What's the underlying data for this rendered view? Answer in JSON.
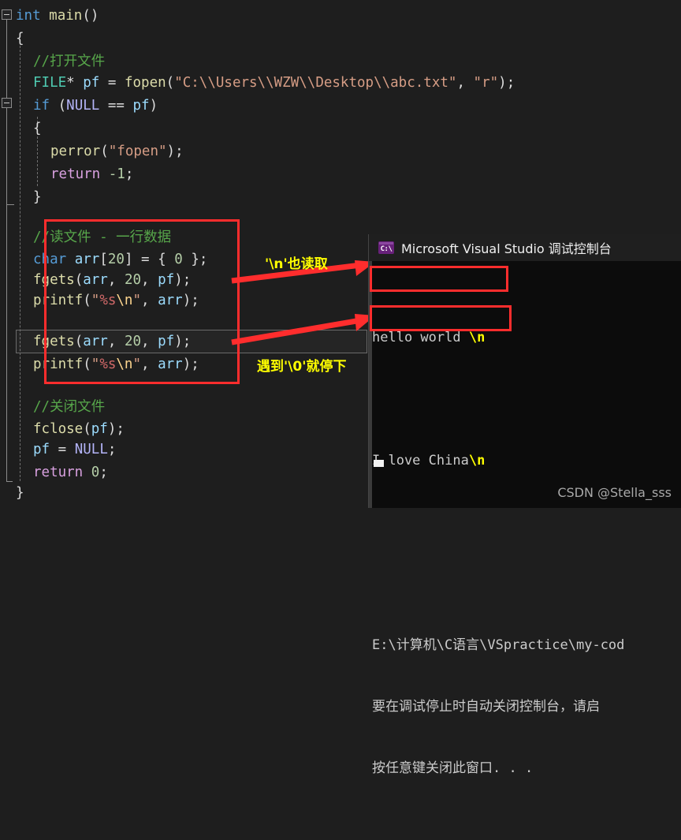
{
  "editor": {
    "theme": {
      "background": "#1e1e1e",
      "comment": "#57a64a",
      "keyword": "#569cd6",
      "control_keyword": "#d8a0df",
      "type": "#4ec9b0",
      "function": "#dcdcaa",
      "variable": "#9cdcfe",
      "macro": "#b4b4f8",
      "string": "#d69d85",
      "escape": "#ffd68f",
      "format_specifier": "#d16969",
      "number": "#b5cea8",
      "annotation_red": "#ff2d2d",
      "annotation_yellow": "#ffff00"
    },
    "lines": [
      {
        "indent": 0,
        "text": "int main()"
      },
      {
        "indent": 0,
        "text": "{"
      },
      {
        "indent": 1,
        "text": "//打开文件"
      },
      {
        "indent": 1,
        "text": "FILE* pf = fopen(\"C:\\\\Users\\\\WZW\\\\Desktop\\\\abc.txt\", \"r\");"
      },
      {
        "indent": 1,
        "text": "if (NULL == pf)"
      },
      {
        "indent": 1,
        "text": "{"
      },
      {
        "indent": 2,
        "text": "perror(\"fopen\");"
      },
      {
        "indent": 2,
        "text": "return -1;"
      },
      {
        "indent": 1,
        "text": "}"
      },
      {
        "indent": 1,
        "text": ""
      },
      {
        "indent": 1,
        "text": "//读文件 - 一行数据"
      },
      {
        "indent": 1,
        "text": "char arr[20] = { 0 };"
      },
      {
        "indent": 1,
        "text": "fgets(arr, 20, pf);"
      },
      {
        "indent": 1,
        "text": "printf(\"%s\\n\", arr);"
      },
      {
        "indent": 1,
        "text": ""
      },
      {
        "indent": 1,
        "text": "fgets(arr, 20, pf);"
      },
      {
        "indent": 1,
        "text": "printf(\"%s\\n\", arr);"
      },
      {
        "indent": 1,
        "text": ""
      },
      {
        "indent": 1,
        "text": "//关闭文件"
      },
      {
        "indent": 1,
        "text": "fclose(pf);"
      },
      {
        "indent": 1,
        "text": "pf = NULL;"
      },
      {
        "indent": 1,
        "text": "return 0;"
      },
      {
        "indent": 0,
        "text": "}"
      }
    ]
  },
  "annotations": {
    "newline_read": "'\\n'也读取",
    "stop_at_nul": "遇到'\\0'就停下"
  },
  "console": {
    "title": "Microsoft Visual Studio 调试控制台",
    "icon": "console-window-icon",
    "output": [
      {
        "text": "hello world ",
        "escape": "\\n"
      },
      {
        "text": "I love China",
        "escape": "\\n"
      }
    ],
    "messages": [
      "E:\\计算机\\C语言\\VSpractice\\my-cod",
      "要在调试停止时自动关闭控制台，请启",
      "按任意键关闭此窗口. . ."
    ]
  },
  "watermark": "CSDN @Stella_sss"
}
